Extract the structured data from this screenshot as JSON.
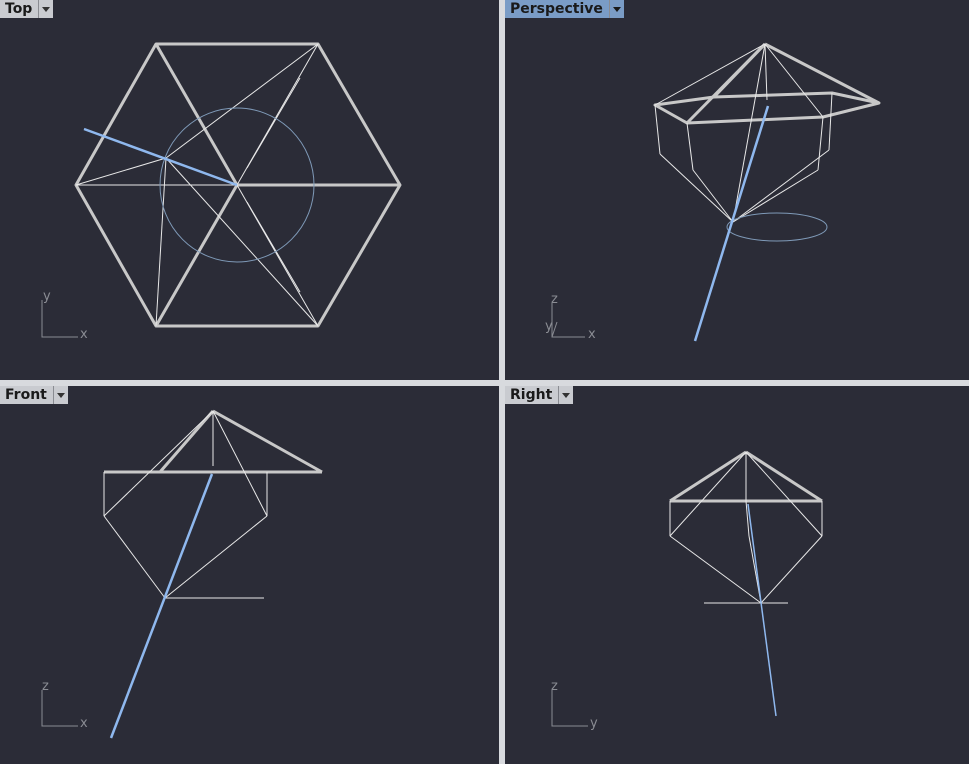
{
  "viewports": {
    "top": {
      "label": "Top",
      "axes": [
        "y",
        "x"
      ]
    },
    "perspective": {
      "label": "Perspective",
      "axes": [
        "z",
        "y",
        "x"
      ]
    },
    "front": {
      "label": "Front",
      "axes": [
        "z",
        "x"
      ]
    },
    "right": {
      "label": "Right",
      "axes": [
        "z",
        "y"
      ]
    }
  },
  "colors": {
    "viewport_bg": "#2b2c37",
    "geometry": "#c8c8c8",
    "selected": "#8fb8ee",
    "active_tab": "#7a9cc6"
  }
}
